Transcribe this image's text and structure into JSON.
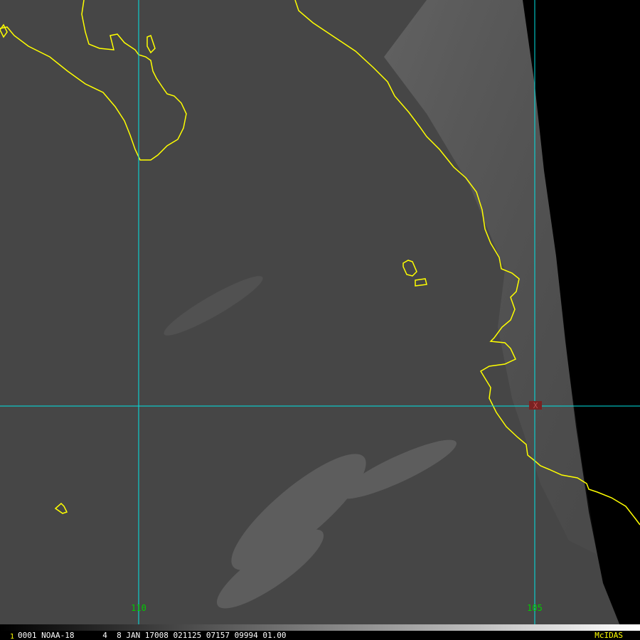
{
  "map": {
    "longitude_labels": [
      "110",
      "105"
    ],
    "target_marker": "X",
    "colors": {
      "ocean": "#464646",
      "space": "#000000",
      "coastline": "#ffff00",
      "grid": "#00e5e5",
      "lon_label": "#00cc00",
      "marker": "#7a2222"
    }
  },
  "status_bar": {
    "frame_number": "1",
    "info": "0001 NOAA-18      4  8 JAN 17008 021125 07157 09994 01.00",
    "software": "McIDAS",
    "colors": {
      "text": "#ffffff",
      "frame": "#ffff00",
      "software": "#ffff00",
      "background": "#000000"
    }
  }
}
